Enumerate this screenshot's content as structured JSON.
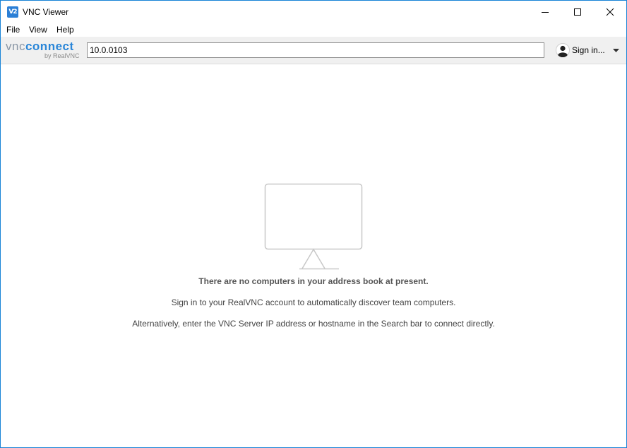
{
  "window": {
    "title": "VNC Viewer",
    "app_icon_text": "V2"
  },
  "menu": {
    "items": [
      "File",
      "View",
      "Help"
    ]
  },
  "toolbar": {
    "logo_vnc": "vnc",
    "logo_connect": "connect",
    "logo_sub": "by RealVNC",
    "address_value": "10.0.0103",
    "signin_label": "Sign in..."
  },
  "empty_state": {
    "title": "There are no computers in your address book at present.",
    "line1": "Sign in to your RealVNC account to automatically discover team computers.",
    "line2": "Alternatively, enter the VNC Server IP address or hostname in the Search bar to connect directly."
  },
  "colors": {
    "window_border": "#1883d7",
    "accent": "#2a86d8",
    "toolbar_bg": "#f0f0f0"
  }
}
